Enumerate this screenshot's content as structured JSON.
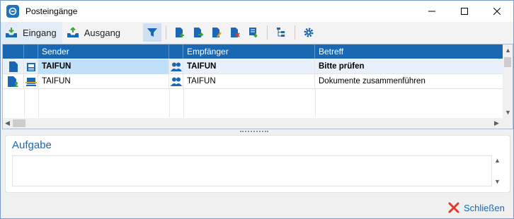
{
  "window": {
    "title": "Posteingänge"
  },
  "tabs": [
    {
      "label": "Eingang",
      "active": true
    },
    {
      "label": "Ausgang",
      "active": false
    }
  ],
  "toolbar_icons": [
    "filter-icon",
    "new-document-icon",
    "forward-document-icon",
    "edit-document-icon",
    "delete-document-icon",
    "export-document-icon",
    "tree-view-icon",
    "settings-gear-icon"
  ],
  "grid": {
    "columns": [
      "Sender",
      "Empfänger",
      "Betreff"
    ],
    "rows": [
      {
        "sender": "TAIFUN",
        "recipient": "TAIFUN",
        "subject": "Bitte prüfen",
        "unread": true
      },
      {
        "sender": "TAIFUN",
        "recipient": "TAIFUN",
        "subject": "Dokumente zusammenführen",
        "unread": false
      }
    ]
  },
  "panel": {
    "title": "Aufgabe",
    "text": ""
  },
  "footer": {
    "close_label": "Schließen"
  },
  "colors": {
    "accent": "#1a68b3",
    "header_bg": "#1a68b3",
    "selected_row": "#e8f1fb",
    "close_red": "#e03a2f"
  }
}
